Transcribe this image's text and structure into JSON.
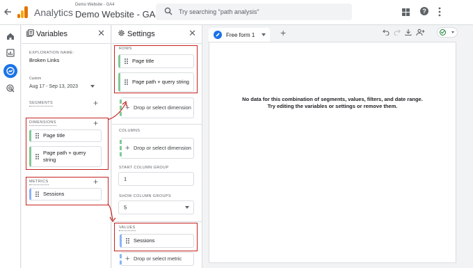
{
  "header": {
    "app_name": "Analytics",
    "property_small": "Demo Website - GA4",
    "property_main": "Demo Website - GA4",
    "search_placeholder": "Try searching \"path analysis\""
  },
  "variables_panel": {
    "title": "Variables",
    "exploration_name_label": "EXPLORATION NAME:",
    "exploration_name": "Broken Links",
    "date_custom_label": "Custom",
    "date_range": "Aug 17 - Sep 13, 2023",
    "segments_label": "SEGMENTS",
    "dimensions_label": "DIMENSIONS",
    "dimensions": [
      "Page title",
      "Page path + query string"
    ],
    "metrics_label": "METRICS",
    "metrics": [
      "Sessions"
    ]
  },
  "settings_panel": {
    "title": "Settings",
    "rows_label": "ROWS",
    "rows": [
      "Page title",
      "Page path + query string"
    ],
    "rows_drop": "Drop or select dimension",
    "columns_label": "COLUMNS",
    "columns_drop": "Drop or select dimension",
    "start_column_group_label": "START COLUMN GROUP",
    "start_column_group": "1",
    "show_column_groups_label": "SHOW COLUMN GROUPS",
    "show_column_groups": "5",
    "values_label": "VALUES",
    "values": [
      "Sessions"
    ],
    "values_drop": "Drop or select metric"
  },
  "canvas": {
    "tab_name": "Free form 1",
    "empty_line1": "No data for this combination of segments, values, filters, and date range.",
    "empty_line2": "Try editing the variables or settings or remove them."
  },
  "colors": {
    "accent": "#1a73e8",
    "dimension": "#81c995",
    "metric": "#8ab4f8",
    "highlight": "#c5221f"
  },
  "icons": [
    "back-arrow-icon",
    "analytics-logo-icon",
    "search-icon",
    "apps-icon",
    "help-icon",
    "more-vert-icon",
    "home-icon",
    "reports-icon",
    "explore-icon",
    "advertising-icon",
    "variables-icon",
    "settings-icon",
    "close-icon",
    "drag-handle-icon",
    "add-icon",
    "pencil-icon",
    "undo-icon",
    "redo-icon",
    "download-icon",
    "share-icon",
    "check-circle-icon"
  ]
}
